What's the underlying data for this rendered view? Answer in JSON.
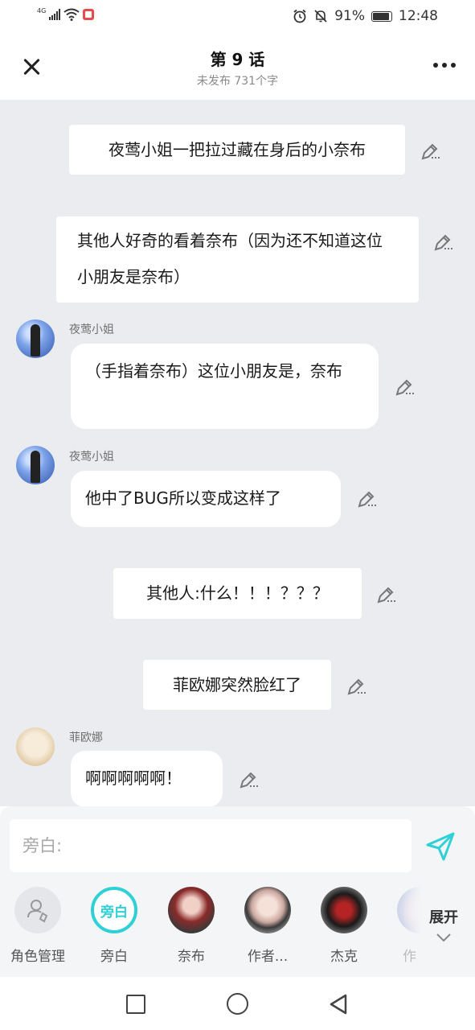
{
  "status": {
    "network": "4G",
    "battery_percent": "91%",
    "battery_level": 0.91,
    "time": "12:48",
    "icons": [
      "signal-icon",
      "wifi-icon",
      "app-badge-icon",
      "alarm-icon",
      "mute-icon",
      "battery-icon"
    ]
  },
  "header": {
    "title": "第 9 话",
    "subtitle": "未发布 731个字"
  },
  "messages": [
    {
      "type": "narration",
      "text": "夜莺小姐一把拉过藏在身后的小奈布"
    },
    {
      "type": "narration",
      "text": "其他人好奇的看着奈布（因为还不知道这位小朋友是奈布）"
    },
    {
      "type": "role",
      "speaker": "夜莺小姐",
      "text": "（手指着奈布）这位小朋友是，奈布"
    },
    {
      "type": "role",
      "speaker": "夜莺小姐",
      "text": "他中了BUG所以变成这样了"
    },
    {
      "type": "narration",
      "text": "其他人:什么！！！？？？"
    },
    {
      "type": "narration",
      "text": "菲欧娜突然脸红了"
    },
    {
      "type": "role",
      "speaker": "菲欧娜",
      "text": "啊啊啊啊啊！"
    }
  ],
  "composer": {
    "placeholder": "旁白:"
  },
  "characters": [
    {
      "label": "角色管理"
    },
    {
      "label": "旁白",
      "badge": "旁白"
    },
    {
      "label": "奈布"
    },
    {
      "label": "作者..."
    },
    {
      "label": "杰克"
    },
    {
      "label": "作"
    }
  ],
  "expand_label": "展开",
  "colors": {
    "accent": "#2fd0d6",
    "chat_background": "#ebecef",
    "bubble": "#ffffff"
  }
}
